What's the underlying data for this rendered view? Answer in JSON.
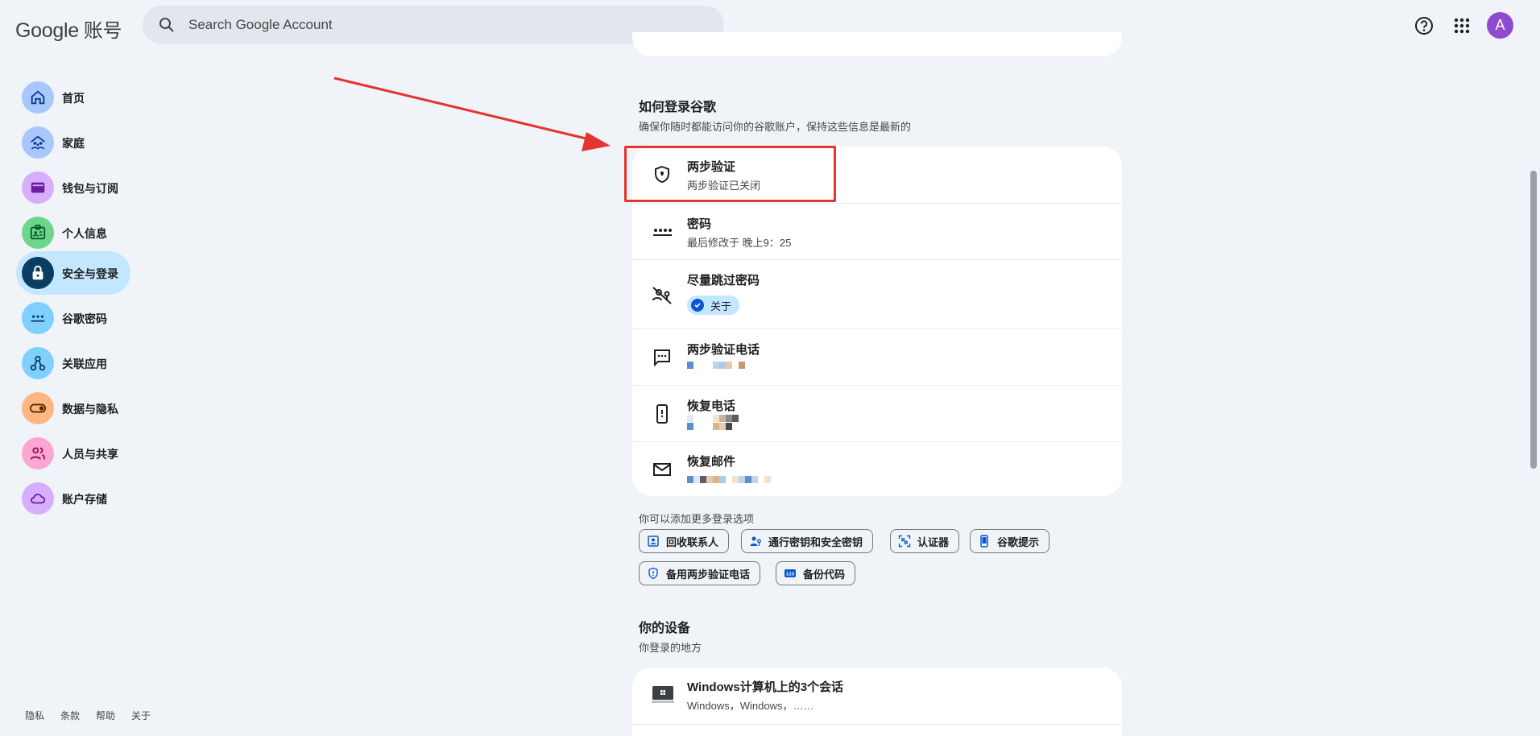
{
  "header": {
    "logo_google": "Google",
    "logo_account": "账号",
    "search_placeholder": "Search Google Account",
    "avatar_letter": "A"
  },
  "sidebar": {
    "items": [
      {
        "label": "首页",
        "icon": "home-icon",
        "color": "#a8c7fa"
      },
      {
        "label": "家庭",
        "icon": "family-icon",
        "color": "#a8c7fa"
      },
      {
        "label": "钱包与订阅",
        "icon": "wallet-icon",
        "color": "#d7aefb"
      },
      {
        "label": "个人信息",
        "icon": "id-card-icon",
        "color": "#6dd58c"
      },
      {
        "label": "安全与登录",
        "icon": "lock-icon",
        "color": "#0b3d62",
        "active": true
      },
      {
        "label": "谷歌密码",
        "icon": "password-icon",
        "color": "#7fcfff"
      },
      {
        "label": "关联应用",
        "icon": "connected-apps-icon",
        "color": "#7fcfff"
      },
      {
        "label": "数据与隐私",
        "icon": "toggle-icon",
        "color": "#ffb683"
      },
      {
        "label": "人员与共享",
        "icon": "people-icon",
        "color": "#fda6d1"
      },
      {
        "label": "账户存储",
        "icon": "cloud-icon",
        "color": "#d7aefb"
      }
    ]
  },
  "footer": {
    "links": [
      "隐私",
      "条款",
      "帮助",
      "关于"
    ]
  },
  "signin": {
    "title": "如何登录谷歌",
    "subtitle": "确保你随时都能访问你的谷歌账户，保持这些信息是最新的",
    "rows": [
      {
        "title": "两步验证",
        "sub": "两步验证已关闭",
        "icon": "shield-icon"
      },
      {
        "title": "密码",
        "sub": "最后修改于 晚上9：25",
        "icon": "password-dots-icon"
      },
      {
        "title": "尽量跳过密码",
        "badge": "关于",
        "icon": "passkey-off-icon"
      },
      {
        "title": "两步验证电话",
        "icon": "message-icon"
      },
      {
        "title": "恢复电话",
        "icon": "phone-icon"
      },
      {
        "title": "恢复邮件",
        "icon": "mail-icon"
      }
    ],
    "more_label": "你可以添加更多登录选项",
    "chips": [
      {
        "label": "回收联系人",
        "icon": "contact-icon"
      },
      {
        "label": "通行密钥和安全密钥",
        "icon": "passkey-icon"
      },
      {
        "label": "认证器",
        "icon": "qr-icon"
      },
      {
        "label": "谷歌提示",
        "icon": "phone-prompt-icon"
      },
      {
        "label": "备用两步验证电话",
        "icon": "shield-backup-icon"
      },
      {
        "label": "备份代码",
        "icon": "backup-code-icon"
      }
    ]
  },
  "devices": {
    "title": "你的设备",
    "subtitle": "你登录的地方",
    "row_title": "Windows计算机上的3个会话",
    "row_sub": "Windows，Windows，……"
  },
  "colors": {
    "accent": "#0b57d0",
    "highlight": "#e5342e",
    "active_nav": "#c2e7ff"
  }
}
